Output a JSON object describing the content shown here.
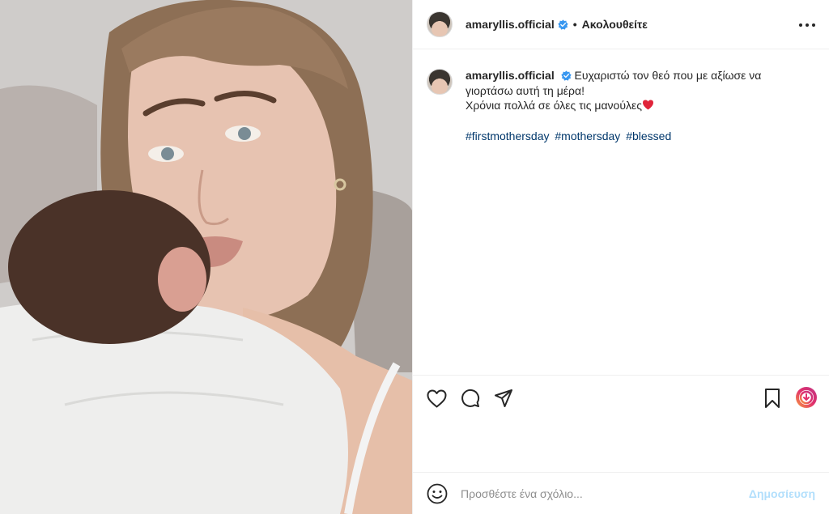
{
  "post": {
    "username": "amaryllis.official",
    "follow_status": "Ακολουθείτε",
    "separator": "•",
    "caption_line1": "Ευχαριστώ τον θεό που με αξίωσε να γιορτάσω αυτή τη μέρα!",
    "caption_line2": "Χρόνια πολλά σε όλες τις μανούλες",
    "caption_emoji": "❤️",
    "hashtags": [
      "#firstmothersday",
      "#mothersday",
      "#blessed"
    ]
  },
  "comment": {
    "placeholder": "Προσθέστε ένα σχόλιο...",
    "post_label": "Δημοσίευση"
  },
  "icons": {
    "verified": "verified-badge-icon",
    "more": "more-options-icon",
    "like": "heart-icon",
    "comment": "comment-icon",
    "share": "send-icon",
    "save": "bookmark-icon",
    "boost": "boost-icon",
    "emoji": "emoji-icon"
  },
  "colors": {
    "hashtag": "#00376b",
    "verified": "#3897f0",
    "post_button": "#b2dffc",
    "border": "#efefef"
  }
}
